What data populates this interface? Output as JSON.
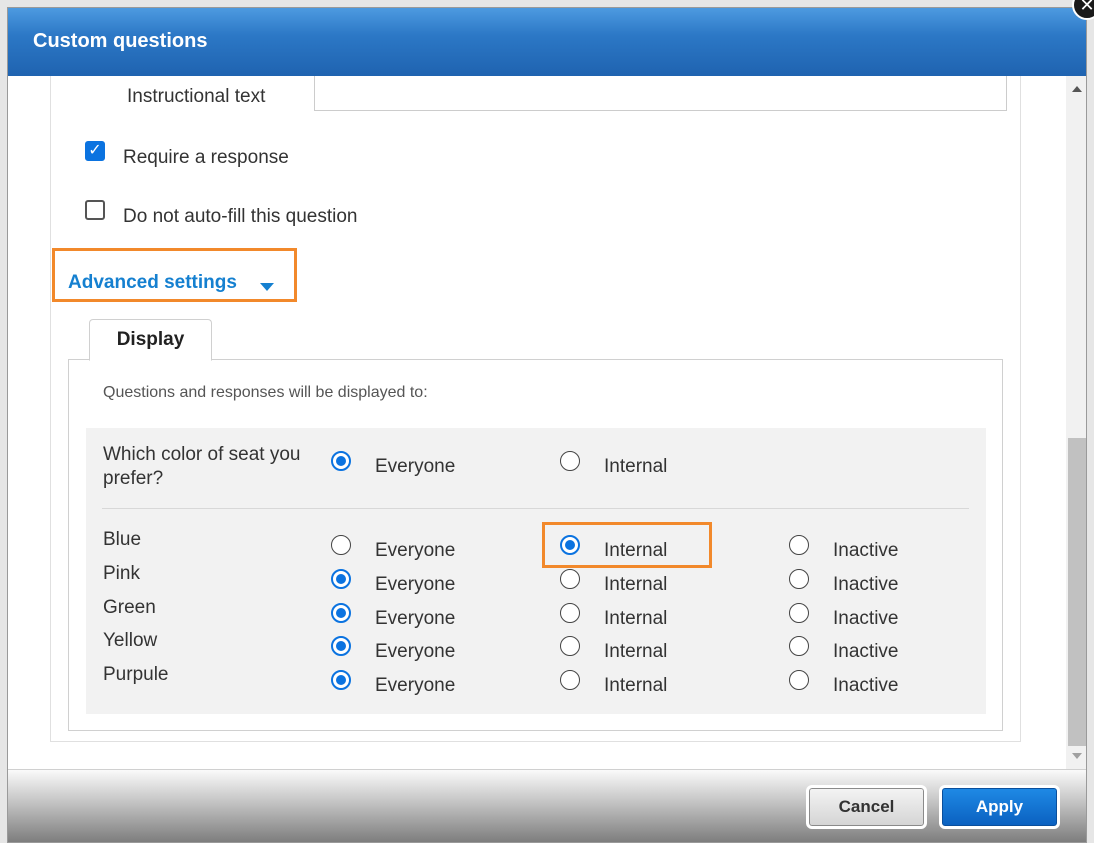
{
  "dialog": {
    "title": "Custom questions",
    "close_icon": "close-icon"
  },
  "form": {
    "instructional_label": "Instructional text",
    "instructional_value": "",
    "require_response_label": "Require a response",
    "require_response_checked": true,
    "no_autofill_label": "Do not auto-fill this question",
    "no_autofill_checked": false,
    "advanced_settings_label": "Advanced settings"
  },
  "display_tab": {
    "tab_label": "Display",
    "info_text": "Questions and responses will be displayed to:",
    "question": {
      "text": "Which color of seat you prefer?",
      "everyone_label": "Everyone",
      "internal_label": "Internal",
      "selected": "Everyone"
    },
    "option_labels": {
      "everyone": "Everyone",
      "internal": "Internal",
      "inactive": "Inactive"
    },
    "rows": [
      {
        "label": "Blue",
        "selected": "Internal"
      },
      {
        "label": "Pink",
        "selected": "Everyone"
      },
      {
        "label": "Green",
        "selected": "Everyone"
      },
      {
        "label": "Yellow",
        "selected": "Everyone"
      },
      {
        "label": "Purpule",
        "selected": "Everyone"
      }
    ]
  },
  "footer": {
    "cancel_label": "Cancel",
    "apply_label": "Apply"
  },
  "colors": {
    "header_blue": "#2c78c6",
    "link_blue": "#1580d0",
    "radio_blue": "#0b73e0",
    "highlight_orange": "#f2892b"
  }
}
